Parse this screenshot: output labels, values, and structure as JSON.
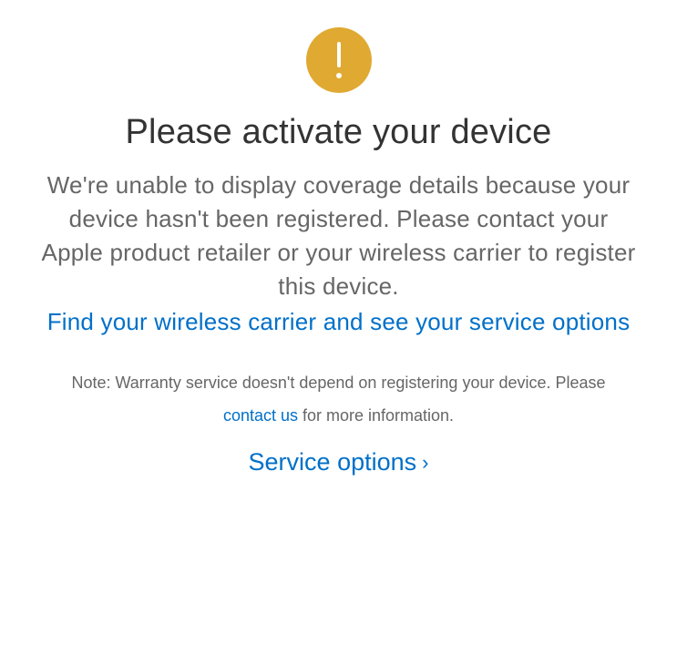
{
  "icon": "alert",
  "heading": "Please activate your device",
  "body": "We're unable to display coverage details because your device hasn't been registered. Please contact your Apple product retailer or your wireless carrier to register this device.",
  "primary_link": "Find your wireless carrier and see your service options",
  "note": {
    "prefix": "Note: Warranty service doesn't depend on registering your device. Please ",
    "link": "contact us",
    "suffix": " for more information."
  },
  "service_options_label": "Service options"
}
